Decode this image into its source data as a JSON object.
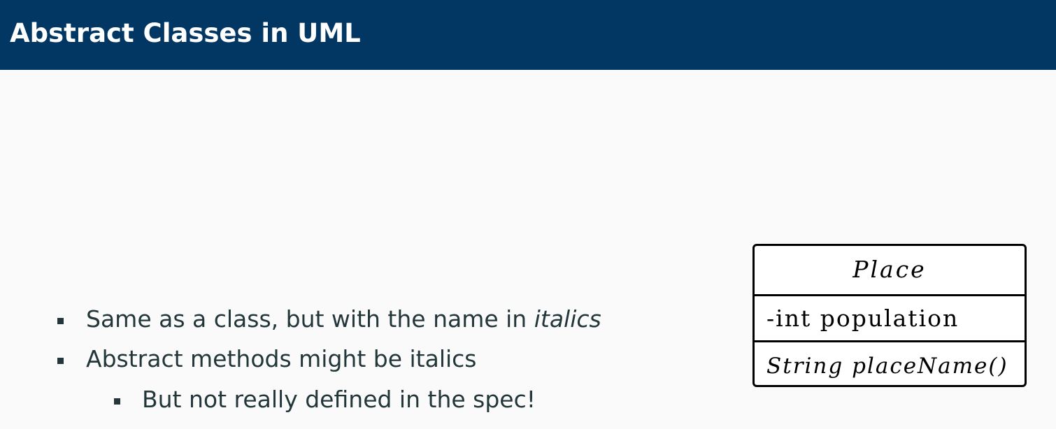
{
  "slide": {
    "title": "Abstract Classes in UML"
  },
  "bullets": [
    {
      "text": "Same as a class, but with the name in ",
      "emphasis": "italics"
    },
    {
      "text": "Abstract methods might be italics"
    },
    {
      "text": "But not really defined in the spec!"
    }
  ],
  "uml_class": {
    "name": "Place",
    "attributes": [
      "-int population"
    ],
    "methods": [
      "String placeName()"
    ]
  },
  "colors": {
    "title_bar": "#023764",
    "title_text": "#ffffff",
    "background": "#fafafa",
    "body_text": "#23373b",
    "uml_border": "#000000"
  }
}
